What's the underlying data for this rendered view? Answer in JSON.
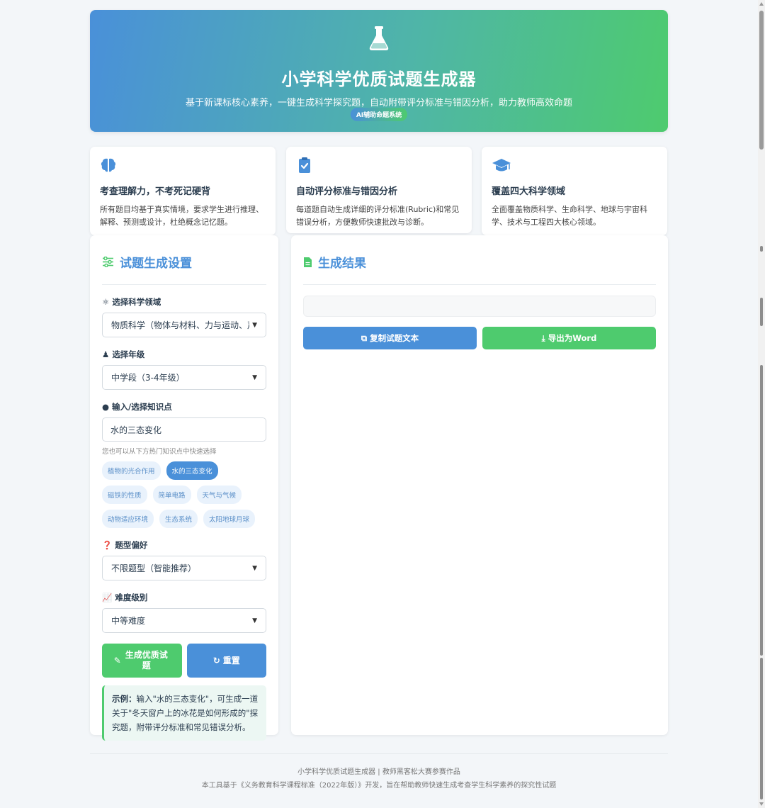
{
  "header": {
    "title": "小学科学优质试题生成器",
    "subtitle": "基于新课标核心素养，一键生成科学探究题，自动附带评分标准与错因分析，助力教师高效命题",
    "badge": "AI辅助命题系统",
    "icon": "flask-icon"
  },
  "features": [
    {
      "icon": "brain-icon",
      "title": "考查理解力，不考死记硬背",
      "desc": "所有题目均基于真实情境，要求学生进行推理、解释、预测或设计，杜绝概念记忆题。"
    },
    {
      "icon": "clipboard-check-icon",
      "title": "自动评分标准与错因分析",
      "desc": "每道题自动生成详细的评分标准(Rubric)和常见错误分析，方便教师快速批改与诊断。"
    },
    {
      "icon": "graduation-cap-icon",
      "title": "覆盖四大科学领域",
      "desc": "全面覆盖物质科学、生命科学、地球与宇宙科学、技术与工程四大核心领域。"
    }
  ],
  "settings": {
    "title": "试题生成设置",
    "domain_label": "选择科学领域",
    "domain_value": "物质科学（物体与材料、力与运动、声",
    "grade_label": "选择年级",
    "grade_value": "中学段（3-4年级）",
    "knowledge_label": "输入/选择知识点",
    "knowledge_value": "水的三态变化",
    "hint": "您也可以从下方热门知识点中快速选择",
    "tags": [
      "植物的光合作用",
      "水的三态变化",
      "磁铁的性质",
      "简单电路",
      "天气与气候",
      "动物适应环境",
      "生态系统",
      "太阳地球月球"
    ],
    "active_tag": "水的三态变化",
    "type_label": "题型偏好",
    "type_value": "不限题型（智能推荐）",
    "difficulty_label": "难度级别",
    "difficulty_value": "中等难度",
    "generate_button": "生成优质试题",
    "reset_button": "重置",
    "example_prefix": "示例：",
    "example_text": "输入\"水的三态变化\"，可生成一道关于\"冬天窗户上的冰花是如何形成的\"探究题，附带评分标准和常见错误分析。"
  },
  "result": {
    "title": "生成结果",
    "copy_button": "复制试题文本",
    "export_button": "导出为Word"
  },
  "footer": {
    "line1": "小学科学优质试题生成器 | 教师黑客松大赛参赛作品",
    "line2": "本工具基于《义务教育科学课程标准（2022年版）》开发，旨在帮助教师快速生成考查学生科学素养的探究性试题"
  },
  "colors": {
    "primary": "#4a90d9",
    "success": "#4ecb6e"
  }
}
